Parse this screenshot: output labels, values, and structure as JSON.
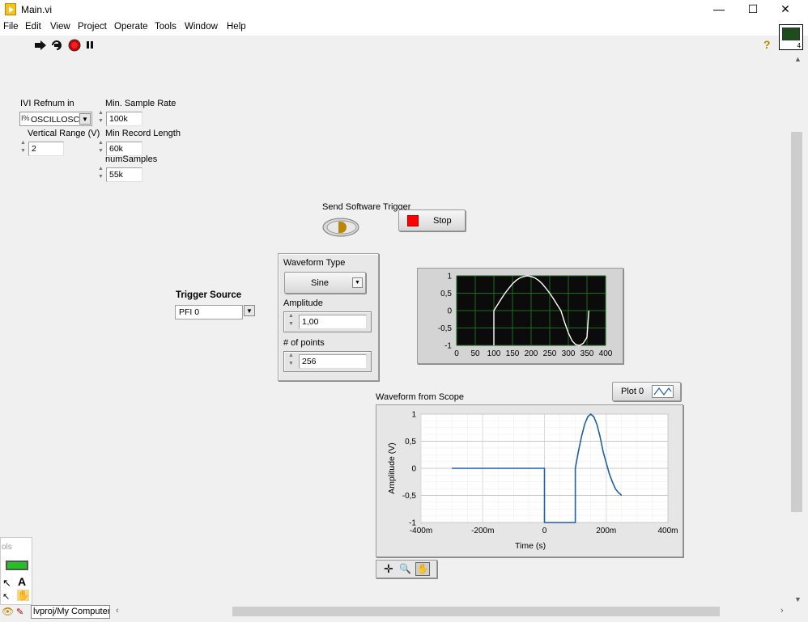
{
  "window": {
    "title": "Main.vi",
    "minimize_glyph": "—",
    "maximize_glyph": "☐",
    "close_glyph": "✕"
  },
  "menu": {
    "items": [
      {
        "label": "File"
      },
      {
        "label": "Edit"
      },
      {
        "label": "View"
      },
      {
        "label": "Project"
      },
      {
        "label": "Operate"
      },
      {
        "label": "Tools"
      },
      {
        "label": "Window"
      },
      {
        "label": "Help"
      }
    ]
  },
  "toolbar": {
    "run_icon": "run-arrow-icon",
    "run_continuously_icon": "run-continuously-icon",
    "abort_icon": "abort-icon",
    "pause_icon": "pause-icon",
    "help_glyph": "?",
    "vi_icon_number": "4"
  },
  "controls": {
    "ivi_refnum": {
      "label": "IVI Refnum in",
      "value": "OSCILLOSC",
      "prefix": "I%"
    },
    "vertical_range": {
      "label": "Vertical Range (V)",
      "value": "2"
    },
    "min_sample_rate": {
      "label": "Min. Sample Rate",
      "value": "100k"
    },
    "min_record_length": {
      "label": "Min Record Length",
      "value": "60k"
    },
    "num_samples": {
      "label": "numSamples",
      "value": "55k"
    },
    "send_software_trigger": {
      "label": "Send Software Trigger"
    },
    "stop": {
      "label": "Stop"
    },
    "trigger_source": {
      "label": "Trigger Source",
      "value": "PFI 0"
    },
    "waveform_type": {
      "label": "Waveform Type",
      "value": "Sine"
    },
    "amplitude": {
      "label": "Amplitude",
      "value": "1,00"
    },
    "num_points": {
      "label": "# of points",
      "value": "256"
    },
    "plot_legend": {
      "label": "Plot 0"
    },
    "status_bar": {
      "project_path": "lvproj/My Computer"
    },
    "tools_palette": {
      "title": "ols"
    }
  },
  "colors": {
    "small_graph_bg": "#0b0b0b",
    "small_graph_grid": "#1d6b1d",
    "small_trace": "#ffffff",
    "scope_trace": "#1f5fa8",
    "stop_red": "#ff0000",
    "trigger_led": "#b8860b"
  },
  "chart_data": [
    {
      "type": "line",
      "title": "",
      "xlabel": "",
      "ylabel": "",
      "xlim": [
        0,
        400
      ],
      "ylim": [
        -1,
        1
      ],
      "x_ticks": [
        "0",
        "50",
        "100",
        "150",
        "200",
        "250",
        "300",
        "350",
        "400"
      ],
      "y_ticks": [
        "1",
        "0,5",
        "0",
        "-0,5",
        "-1"
      ],
      "grid": true,
      "series": [
        {
          "x": [
            100,
            100,
            110,
            120,
            130,
            140,
            150,
            160,
            170,
            180,
            190,
            200,
            210,
            220,
            230,
            240,
            250,
            260,
            270,
            280,
            290,
            300,
            310,
            320,
            330,
            340,
            350,
            355
          ],
          "values": [
            -1,
            0,
            0.17,
            0.34,
            0.5,
            0.64,
            0.77,
            0.87,
            0.94,
            0.98,
            1.0,
            0.98,
            0.94,
            0.87,
            0.77,
            0.64,
            0.5,
            0.34,
            0.17,
            0,
            -0.34,
            -0.64,
            -0.87,
            -0.98,
            -1.0,
            -0.94,
            -0.77,
            0
          ]
        }
      ]
    },
    {
      "type": "line",
      "title": "Waveform from Scope",
      "xlabel": "Time (s)",
      "ylabel": "Amplitude (V)",
      "xlim": [
        -0.4,
        0.4
      ],
      "ylim": [
        -1,
        1
      ],
      "x_ticks": [
        "-400m",
        "-200m",
        "0",
        "200m",
        "400m"
      ],
      "y_ticks": [
        "1",
        "0,5",
        "0",
        "-0,5",
        "-1"
      ],
      "grid": true,
      "series": [
        {
          "name": "Plot 0",
          "x": [
            -0.3,
            0,
            0,
            0.1,
            0.1,
            0.11,
            0.12,
            0.13,
            0.14,
            0.15,
            0.16,
            0.17,
            0.18,
            0.19,
            0.2,
            0.21,
            0.22,
            0.23,
            0.24,
            0.25
          ],
          "values": [
            0,
            0,
            -1,
            -1,
            0,
            0.31,
            0.59,
            0.81,
            0.95,
            1.0,
            0.95,
            0.81,
            0.59,
            0.31,
            0.1,
            -0.1,
            -0.25,
            -0.38,
            -0.45,
            -0.5
          ]
        }
      ]
    }
  ]
}
